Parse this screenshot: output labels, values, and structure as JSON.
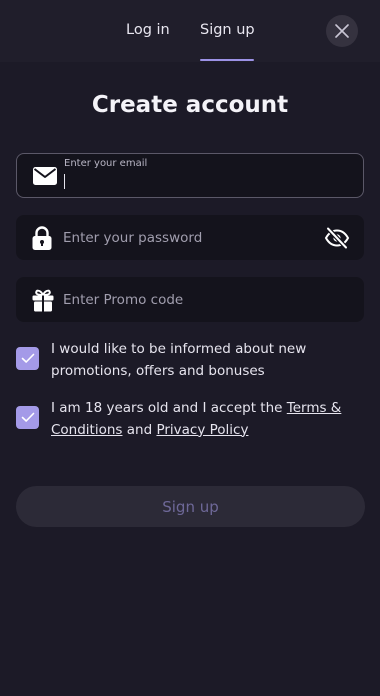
{
  "tabs": {
    "login": "Log in",
    "signup": "Sign up"
  },
  "title": "Create account",
  "email": {
    "label": "Enter your email",
    "value": ""
  },
  "password": {
    "placeholder": "Enter your password",
    "value": ""
  },
  "promo": {
    "placeholder": "Enter Promo code",
    "value": ""
  },
  "consents": {
    "promotions": {
      "text": "I would like to be informed about new promotions, offers and bonuses",
      "checked": true
    },
    "age": {
      "text_before": "I am 18 years old and I accept the ",
      "terms_link": "Terms & Conditions",
      "text_and": " and ",
      "privacy_link": "Privacy Policy",
      "checked": true
    }
  },
  "submit_label": "Sign up",
  "icons": {
    "close": "close-icon",
    "email": "envelope-icon",
    "password": "lock-icon",
    "visibility": "eye-off-icon",
    "promo": "gift-icon",
    "check": "checkmark-icon"
  },
  "colors": {
    "background": "#1c1a27",
    "accent": "#a49ae8",
    "field_background": "#14131c",
    "button_background": "#2c2a37",
    "button_text": "#6e6898"
  }
}
